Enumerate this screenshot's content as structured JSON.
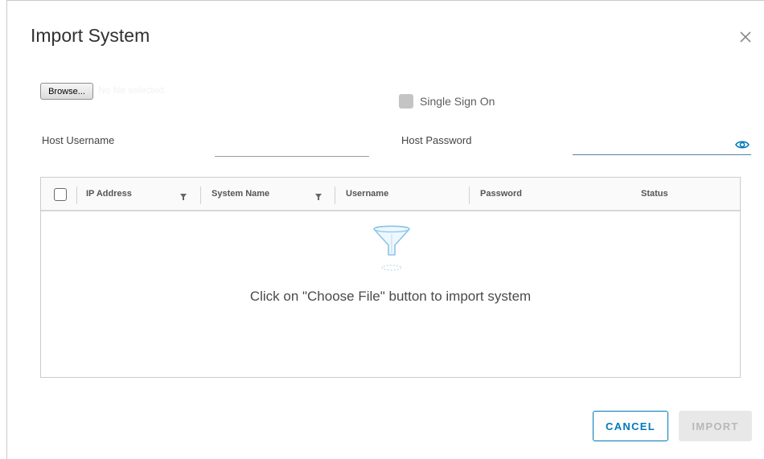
{
  "dialog": {
    "title": "Import System"
  },
  "file": {
    "browse_label": "Browse...",
    "status_text": "No file selected."
  },
  "sso": {
    "label": "Single Sign On",
    "checked": false
  },
  "credentials": {
    "username_label": "Host Username",
    "username_value": "",
    "password_label": "Host Password",
    "password_value": ""
  },
  "grid": {
    "columns": [
      "IP Address",
      "System Name",
      "Username",
      "Password",
      "Status"
    ],
    "rows": [],
    "empty_message": "Click on \"Choose File\" button to import system"
  },
  "actions": {
    "cancel_label": "CANCEL",
    "import_label": "IMPORT"
  },
  "colors": {
    "accent": "#0079b8",
    "disabled_bg": "#e8e8e8",
    "disabled_text": "#b8b8b8",
    "empty_icon": "#8cc4e8"
  }
}
